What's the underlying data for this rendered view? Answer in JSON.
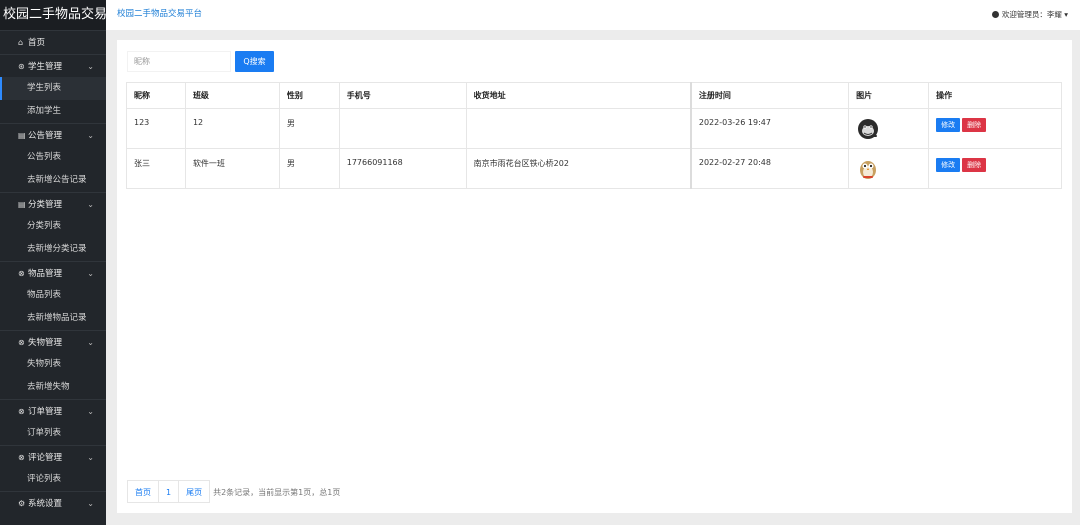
{
  "sidebar": {
    "brand": "校园二手物品交易",
    "home": "首页",
    "groups": [
      {
        "label": "学生管理",
        "items": [
          "学生列表",
          "添加学生"
        ]
      },
      {
        "label": "公告管理",
        "items": [
          "公告列表",
          "去新增公告记录"
        ]
      },
      {
        "label": "分类管理",
        "items": [
          "分类列表",
          "去新增分类记录"
        ]
      },
      {
        "label": "物品管理",
        "items": [
          "物品列表",
          "去新增物品记录"
        ]
      },
      {
        "label": "失物管理",
        "items": [
          "失物列表",
          "去新增失物"
        ]
      },
      {
        "label": "订单管理",
        "items": [
          "订单列表"
        ]
      },
      {
        "label": "评论管理",
        "items": [
          "评论列表"
        ]
      },
      {
        "label": "系统设置",
        "items": []
      }
    ],
    "active_item": "学生列表"
  },
  "topbar": {
    "title": "校园二手物品交易平台",
    "user": "欢迎管理员：李耀 ▾"
  },
  "search": {
    "placeholder": "昵称",
    "button": "Q搜索"
  },
  "table": {
    "headers": [
      "昵称",
      "班级",
      "性别",
      "手机号",
      "收货地址",
      "注册时间",
      "图片",
      "操作"
    ],
    "rows": [
      {
        "nickname": "123",
        "class": "12",
        "gender": "男",
        "phone": "",
        "address": "",
        "registered": "2022-03-26 19:47",
        "avatar": "gorilla-avatar-icon"
      },
      {
        "nickname": "张三",
        "class": "软件一班",
        "gender": "男",
        "phone": "17766091168",
        "address": "南京市雨花台区铁心桥202",
        "registered": "2022-02-27 20:48",
        "avatar": "owl-avatar-icon"
      }
    ],
    "edit_label": "修改",
    "delete_label": "删除"
  },
  "pager": {
    "first": "首页",
    "page": "1",
    "last": "尾页",
    "info": "共2条记录，当前显示第1页，总1页"
  },
  "colors": {
    "sidebar_bg": "#22262b",
    "accent": "#1a7cf2",
    "danger": "#dc3545"
  }
}
